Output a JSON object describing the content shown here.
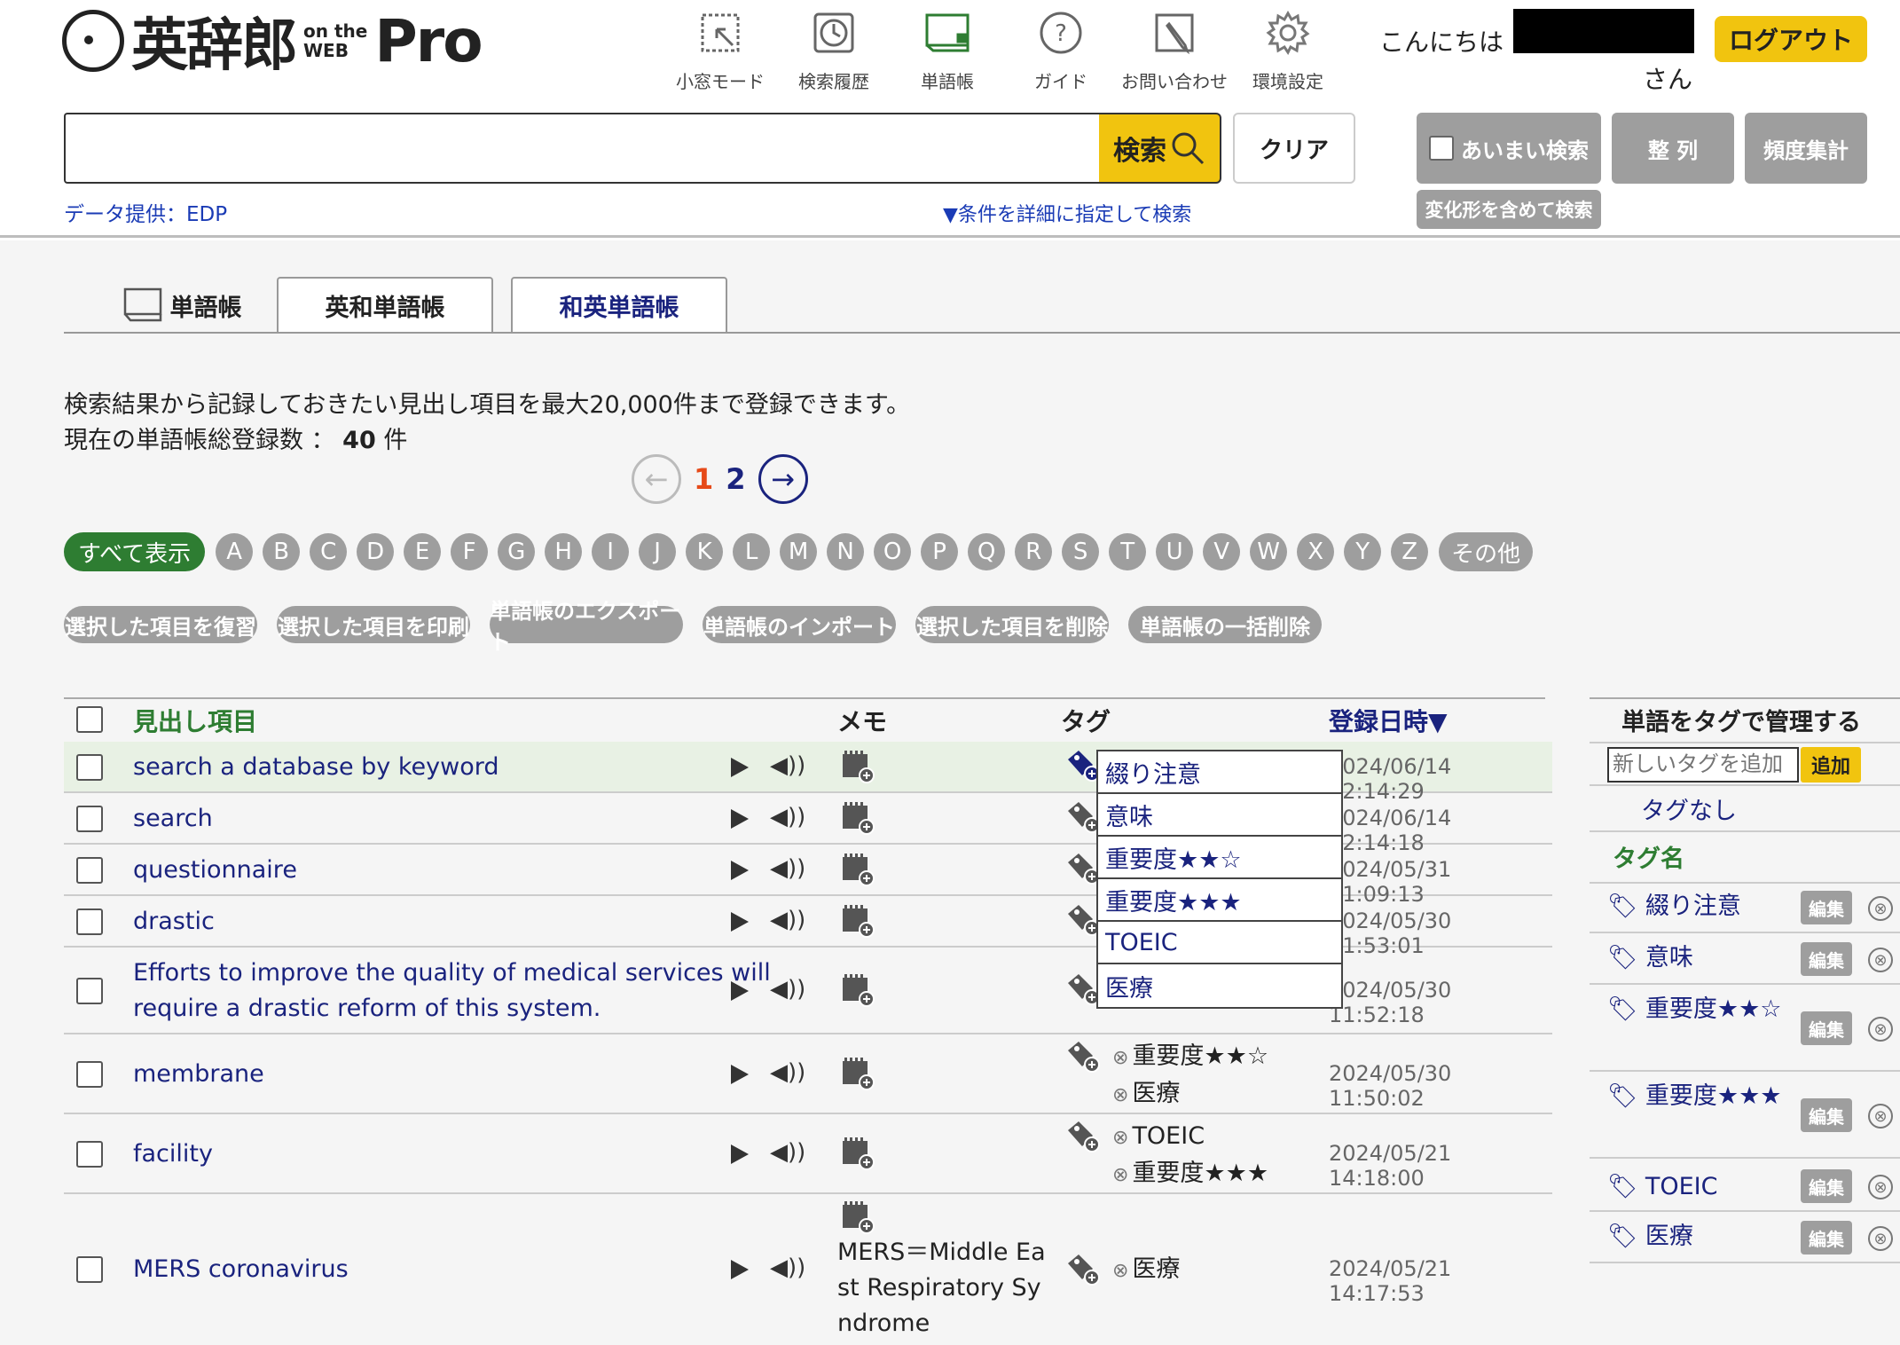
{
  "header": {
    "logo": {
      "main": "英辞郎",
      "on_the": "on the",
      "web": "WEB",
      "pro": "Pro"
    },
    "nav": [
      {
        "label": "小窓モード",
        "icon": "mini-window-icon"
      },
      {
        "label": "検索履歴",
        "icon": "history-clock-icon"
      },
      {
        "label": "単語帳",
        "icon": "wordbook-icon"
      },
      {
        "label": "ガイド",
        "icon": "help-question-icon"
      },
      {
        "label": "お問い合わせ",
        "icon": "inquiry-pen-icon"
      },
      {
        "label": "環境設定",
        "icon": "gear-icon"
      }
    ],
    "greeting": "こんにちは",
    "greeting_suffix": "さん",
    "logout": "ログアウト"
  },
  "search": {
    "value": "",
    "placeholder": "",
    "search_label": "検索",
    "clear_label": "クリア",
    "fuzzy_label": "あいまい検索",
    "sort_label": "整 列",
    "frequency_label": "頻度集計",
    "variant_label": "変化形を含めて検索",
    "data_credit": "データ提供：EDP",
    "advanced_link": "▼条件を詳細に指定して検索"
  },
  "tabs": [
    {
      "label": "単語帳"
    },
    {
      "label": "英和単語帳"
    },
    {
      "label": "和英単語帳"
    }
  ],
  "info": {
    "line1": "検索結果から記録しておきたい見出し項目を最大20,000件まで登録できます。",
    "line2_prefix": "現在の単語帳総登録数 ： ",
    "count": "40",
    "count_unit": " 件"
  },
  "pager": {
    "prev": "←",
    "current": "1",
    "next_page": "2",
    "next": "→"
  },
  "alphabet": {
    "all": "すべて表示",
    "letters": [
      "A",
      "B",
      "C",
      "D",
      "E",
      "F",
      "G",
      "H",
      "I",
      "J",
      "K",
      "L",
      "M",
      "N",
      "O",
      "P",
      "Q",
      "R",
      "S",
      "T",
      "U",
      "V",
      "W",
      "X",
      "Y",
      "Z"
    ],
    "other": "その他"
  },
  "actions": [
    "選択した項目を復習",
    "選択した項目を印刷",
    "単語帳のエクスポート",
    "単語帳のインポート",
    "選択した項目を削除",
    "単語帳の一括削除"
  ],
  "table": {
    "headers": {
      "headword": "見出し項目",
      "memo": "メモ",
      "tag": "タグ",
      "date": "登録日時▼"
    },
    "rows": [
      {
        "word": "search a database by keyword",
        "memo": "",
        "tags": [],
        "date": "2024/06/14 12:14:29"
      },
      {
        "word": "search",
        "memo": "",
        "tags": [],
        "date": "2024/06/14 12:14:18"
      },
      {
        "word": "questionnaire",
        "memo": "",
        "tags": [],
        "date": "2024/05/31 11:09:13"
      },
      {
        "word": "drastic",
        "memo": "",
        "tags": [],
        "date": "2024/05/30 11:53:01"
      },
      {
        "word": "Efforts to improve the quality of medical services will require a drastic reform of this system.",
        "memo": "",
        "tags": [],
        "date": "2024/05/30 11:52:18"
      },
      {
        "word": "membrane",
        "memo": "",
        "tags": [
          "重要度★★☆",
          "医療"
        ],
        "date": "2024/05/30 11:50:02"
      },
      {
        "word": "facility",
        "memo": "",
        "tags": [
          "TOEIC",
          "重要度★★★"
        ],
        "date": "2024/05/21 14:18:00"
      },
      {
        "word": "MERS coronavirus",
        "memo": "MERS＝Middle East Respiratory Syndrome",
        "tags": [
          "医療"
        ],
        "date": "2024/05/21 14:17:53"
      }
    ]
  },
  "tag_dropdown": [
    "綴り注意",
    "意味",
    "重要度★★☆",
    "重要度★★★",
    "TOEIC",
    "医療"
  ],
  "sidebar": {
    "title": "単語をタグで管理する",
    "input_placeholder": "新しいタグを追加",
    "add_label": "追加",
    "no_tag": "タグなし",
    "tag_header": "タグ名",
    "edit_label": "編集",
    "delete_symbol": "⊗",
    "tags": [
      "綴り注意",
      "意味",
      "重要度★★☆",
      "重要度★★★",
      "TOEIC",
      "医療"
    ]
  },
  "colors": {
    "accent_yellow": "#f1c40f",
    "green": "#2e7d32",
    "navy": "#1a237e",
    "gray_button": "#9e9e9e"
  }
}
